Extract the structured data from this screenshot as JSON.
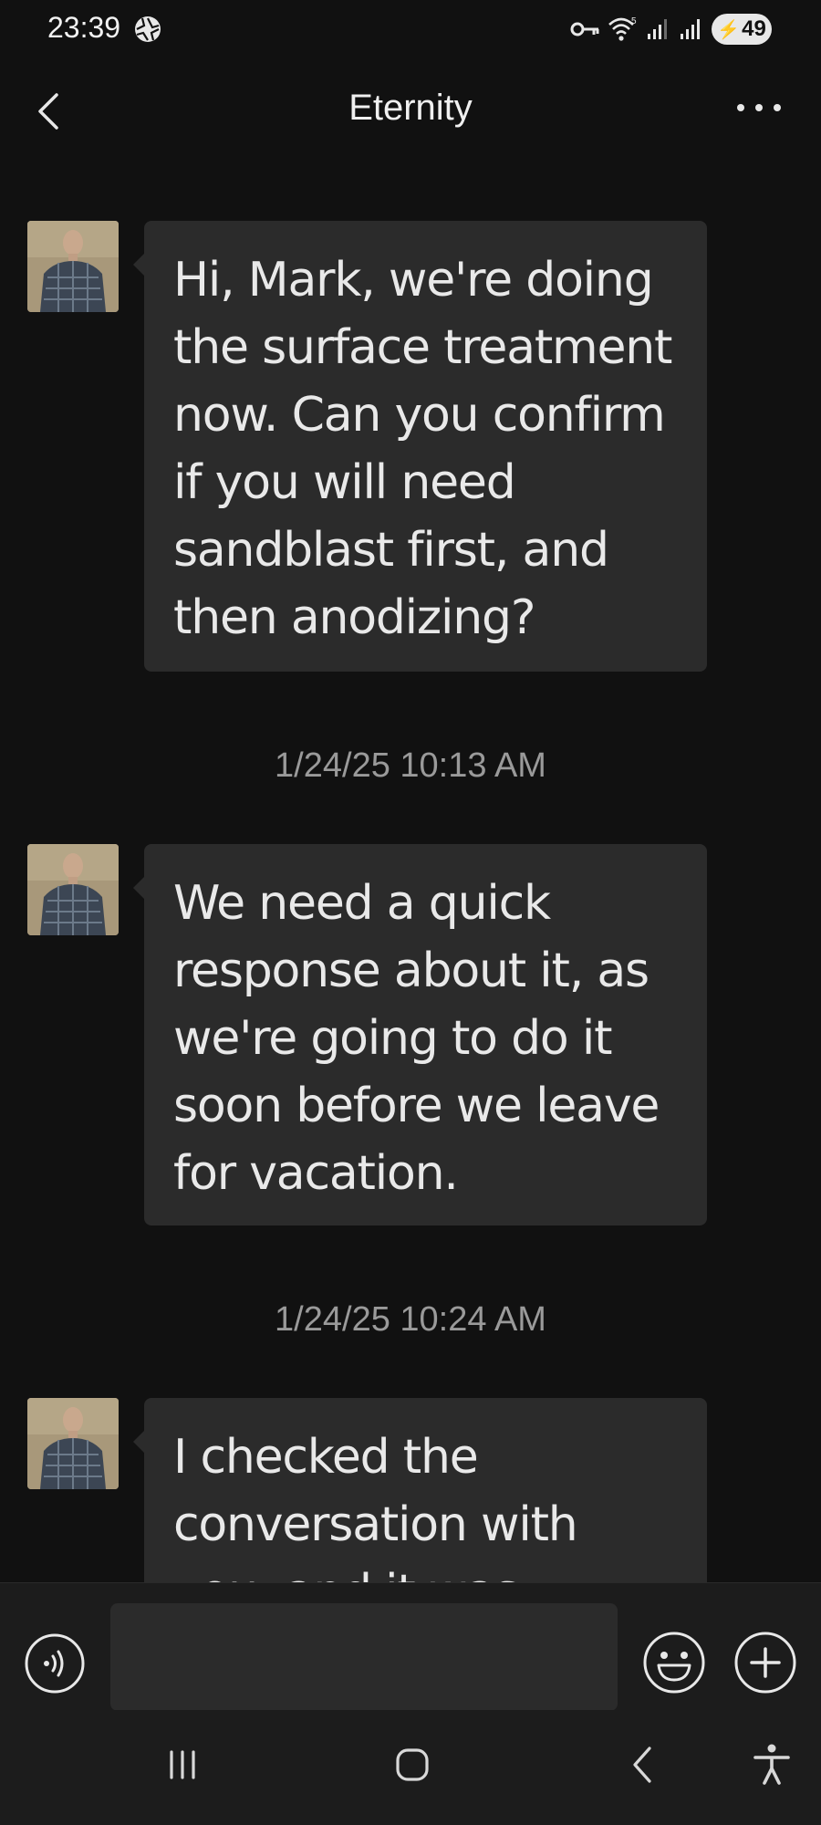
{
  "status_bar": {
    "time": "23:39",
    "battery_level": "49",
    "wifi_label": "5",
    "icons": [
      "aperture-icon",
      "vpn-key-icon",
      "wifi-icon",
      "signal-icon",
      "signal-icon",
      "battery-charging-icon"
    ]
  },
  "header": {
    "title": "Eternity",
    "back_icon": "chevron-left-icon",
    "more_icon": "more-horizontal-icon"
  },
  "messages": [
    {
      "text": "Hi, Mark, we're doing the surface treatment now. Can you confirm if you will need sandblast first, and then anodizing?"
    },
    {
      "timestamp": "1/24/25 10:13 AM",
      "text": "We need a quick response about it, as we're going to do it soon before we leave for vacation."
    },
    {
      "timestamp": "1/24/25 10:24 AM",
      "text": "I checked the conversation with you, and it was"
    }
  ],
  "composer": {
    "placeholder": "",
    "voice_icon": "voice-message-icon",
    "emoji_icon": "emoji-icon",
    "add_icon": "add-icon"
  },
  "nav_bar": {
    "items": [
      "recent-apps-icon",
      "home-icon",
      "back-icon",
      "accessibility-icon"
    ]
  },
  "colors": {
    "background": "#111111",
    "bubble": "#2b2b2b",
    "text": "#e9e9e9",
    "timestamp": "#9a9a9a"
  }
}
